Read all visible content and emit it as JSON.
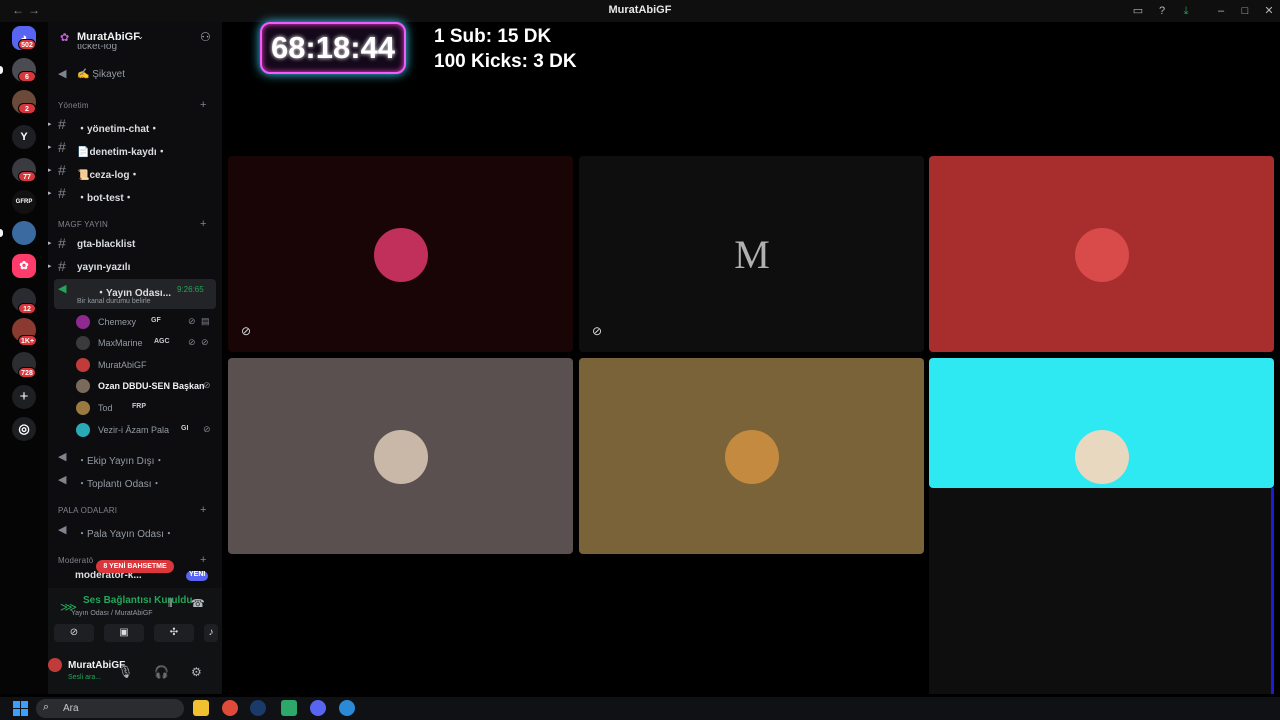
{
  "window": {
    "title": "MuratAbiGF",
    "back": "←",
    "forward": "→"
  },
  "rail": {
    "home_badge": "502",
    "servers": [
      {
        "badge": "6"
      },
      {
        "badge": "2"
      },
      {
        "letter": "Y"
      },
      {
        "badge": "77"
      },
      {
        "letter": "GFRP"
      },
      {},
      {},
      {
        "badge": "12"
      },
      {
        "badge": "1K+"
      },
      {
        "badge": "728"
      }
    ]
  },
  "server": {
    "name": "MuratAbiGF"
  },
  "channels": {
    "partial_top": "ticket-log",
    "sikayet": "✍ Şikayet",
    "cat_yonetim": "Yönetim",
    "yonetim_chat": "・yönetim-chat・",
    "denetim": "📄denetim-kaydı・",
    "ceza": "📜ceza-log・",
    "bot_test": "・bot-test・",
    "cat_magf": "MAGF YAYIN",
    "gta": "gta-blacklist",
    "yayin_yazili": "yayın-yazılı",
    "voice_active": "・Yayın Odası...",
    "voice_timer": "9:26:65",
    "voice_status": "Bir kanal durumu belirle",
    "ekip": "・Ekip Yayın Dışı・",
    "toplanti": "・Toplantı Odası・",
    "cat_pala": "PALA ODALARI",
    "pala": "・Pala Yayın Odası・",
    "cat_mod": "Moderatö",
    "moderator": "moderatör-k...",
    "new_badge": "YENİ",
    "mentions_banner": "8 YENİ BAHSETME"
  },
  "voice_users": [
    {
      "name": "Chemexy",
      "tag": "GF",
      "color": "#8e2a8f"
    },
    {
      "name": "MaxMarine",
      "tag": "AGC",
      "color": "#3a3a3a"
    },
    {
      "name": "MuratAbiGF",
      "tag": "",
      "color": "#c23b3b"
    },
    {
      "name": "Ozan DBDU-SEN Başkan",
      "tag": "",
      "color": "#7a6a5c"
    },
    {
      "name": "Tod",
      "tag": "FRP",
      "color": "#9a7a40"
    },
    {
      "name": "Vezir-i Âzam Pala",
      "tag": "GI",
      "color": "#2aa9b8"
    }
  ],
  "voice_panel": {
    "status": "Ses Bağlantısı Kuruldu",
    "sub": "Yayın Odası / MuratAbiGF"
  },
  "user_area": {
    "name": "MuratAbiGF",
    "sub": "Sesli ara..."
  },
  "stage": {
    "timer": "68:18:44",
    "line1": "1 Sub: 15 DK",
    "line2": "100 Kicks: 3 DK",
    "tiles": [
      {
        "bg": "#1a0506",
        "avatar": "#c0305a",
        "letter": "",
        "mute": "true"
      },
      {
        "bg": "#0e0e0e",
        "avatar": "",
        "letter": "M",
        "mute": "true"
      },
      {
        "bg": "#a82e2e",
        "avatar": "#d94a4a",
        "letter": "",
        "mute": ""
      },
      {
        "bg": "#59504f",
        "avatar": "#c9b8a8",
        "letter": "",
        "mute": ""
      },
      {
        "bg": "#7a6338",
        "avatar": "#c48a40",
        "letter": "",
        "mute": ""
      },
      {
        "bg": "#2ee8f2",
        "avatar": "#e8d8c0",
        "letter": "",
        "mute": ""
      }
    ]
  },
  "taskbar": {
    "search_placeholder": "Ara"
  }
}
